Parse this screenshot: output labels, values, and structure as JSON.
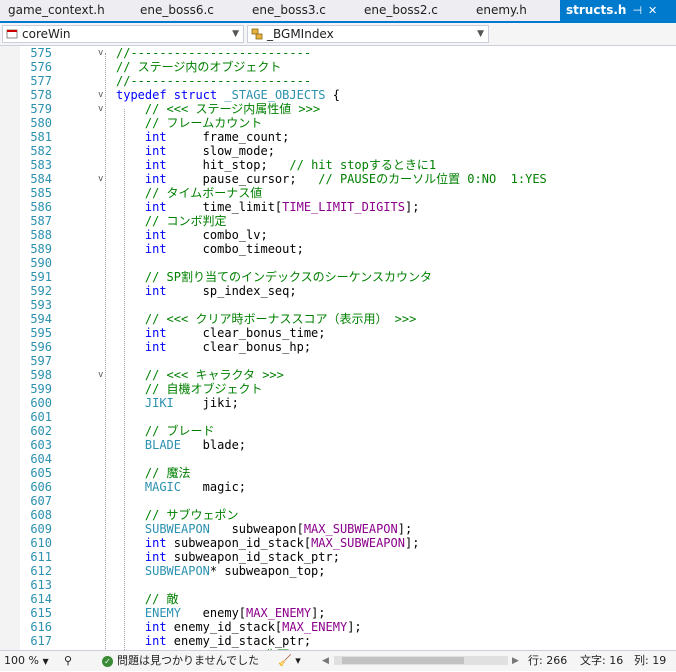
{
  "tabs": [
    {
      "label": "game_context.h"
    },
    {
      "label": "ene_boss6.c"
    },
    {
      "label": "ene_boss3.c"
    },
    {
      "label": "ene_boss2.c"
    },
    {
      "label": "enemy.h"
    },
    {
      "label": "structs.h",
      "pin": "⊣",
      "close": "✕"
    }
  ],
  "nav": {
    "scope": "coreWin",
    "member": "_BGMIndex"
  },
  "code_lines": [
    {
      "n": "575",
      "fold": "v",
      "seg": [
        [
          "c",
          "//-------------------------"
        ]
      ]
    },
    {
      "n": "576",
      "seg": [
        [
          "c",
          "// ステージ内のオブジェクト"
        ]
      ]
    },
    {
      "n": "577",
      "seg": [
        [
          "c",
          "//-------------------------"
        ]
      ]
    },
    {
      "n": "578",
      "fold": "v",
      "indent": 0,
      "seg": [
        [
          "k",
          "typedef struct "
        ],
        [
          "t",
          "_STAGE_OBJECTS"
        ],
        [
          "x",
          " {"
        ]
      ]
    },
    {
      "n": "579",
      "fold": "v",
      "indent": 1,
      "seg": [
        [
          "c",
          "// <<< ステージ内属性値 >>>"
        ]
      ]
    },
    {
      "n": "580",
      "indent": 1,
      "seg": [
        [
          "c",
          "// フレームカウント"
        ]
      ]
    },
    {
      "n": "581",
      "indent": 1,
      "seg": [
        [
          "k",
          "int"
        ],
        [
          "x",
          "     frame_count;"
        ]
      ]
    },
    {
      "n": "582",
      "indent": 1,
      "seg": [
        [
          "k",
          "int"
        ],
        [
          "x",
          "     slow_mode;"
        ]
      ]
    },
    {
      "n": "583",
      "indent": 1,
      "seg": [
        [
          "k",
          "int"
        ],
        [
          "x",
          "     hit_stop;   "
        ],
        [
          "c",
          "// hit stopするときに1"
        ]
      ]
    },
    {
      "n": "584",
      "fold": "v",
      "indent": 1,
      "seg": [
        [
          "k",
          "int"
        ],
        [
          "x",
          "     pause_cursor;   "
        ],
        [
          "c",
          "// PAUSEのカーソル位置 0:NO  1:YES"
        ]
      ]
    },
    {
      "n": "585",
      "indent": 1,
      "seg": [
        [
          "c",
          "// タイムボーナス値"
        ]
      ]
    },
    {
      "n": "586",
      "indent": 1,
      "seg": [
        [
          "k",
          "int"
        ],
        [
          "x",
          "     time_limit["
        ],
        [
          "m",
          "TIME_LIMIT_DIGITS"
        ],
        [
          "x",
          "];"
        ]
      ]
    },
    {
      "n": "587",
      "indent": 1,
      "seg": [
        [
          "c",
          "// コンボ判定"
        ]
      ]
    },
    {
      "n": "588",
      "indent": 1,
      "seg": [
        [
          "k",
          "int"
        ],
        [
          "x",
          "     combo_lv;"
        ]
      ]
    },
    {
      "n": "589",
      "indent": 1,
      "seg": [
        [
          "k",
          "int"
        ],
        [
          "x",
          "     combo_timeout;"
        ]
      ]
    },
    {
      "n": "590",
      "indent": 1,
      "seg": []
    },
    {
      "n": "591",
      "indent": 1,
      "seg": [
        [
          "c",
          "// SP割り当てのインデックスのシーケンスカウンタ"
        ]
      ]
    },
    {
      "n": "592",
      "indent": 1,
      "seg": [
        [
          "k",
          "int"
        ],
        [
          "x",
          "     sp_index_seq;"
        ]
      ]
    },
    {
      "n": "593",
      "indent": 1,
      "seg": []
    },
    {
      "n": "594",
      "indent": 1,
      "seg": [
        [
          "c",
          "// <<< クリア時ボーナススコア（表示用） >>>"
        ]
      ]
    },
    {
      "n": "595",
      "indent": 1,
      "seg": [
        [
          "k",
          "int"
        ],
        [
          "x",
          "     clear_bonus_time;"
        ]
      ]
    },
    {
      "n": "596",
      "indent": 1,
      "seg": [
        [
          "k",
          "int"
        ],
        [
          "x",
          "     clear_bonus_hp;"
        ]
      ]
    },
    {
      "n": "597",
      "indent": 1,
      "seg": []
    },
    {
      "n": "598",
      "fold": "v",
      "indent": 1,
      "seg": [
        [
          "c",
          "// <<< キャラクタ >>>"
        ]
      ]
    },
    {
      "n": "599",
      "indent": 1,
      "seg": [
        [
          "c",
          "// 自機オブジェクト"
        ]
      ]
    },
    {
      "n": "600",
      "indent": 1,
      "seg": [
        [
          "t",
          "JIKI"
        ],
        [
          "x",
          "    jiki;"
        ]
      ]
    },
    {
      "n": "601",
      "indent": 1,
      "seg": []
    },
    {
      "n": "602",
      "indent": 1,
      "seg": [
        [
          "c",
          "// ブレード"
        ]
      ]
    },
    {
      "n": "603",
      "indent": 1,
      "seg": [
        [
          "t",
          "BLADE"
        ],
        [
          "x",
          "   blade;"
        ]
      ]
    },
    {
      "n": "604",
      "indent": 1,
      "seg": []
    },
    {
      "n": "605",
      "indent": 1,
      "seg": [
        [
          "c",
          "// 魔法"
        ]
      ]
    },
    {
      "n": "606",
      "indent": 1,
      "seg": [
        [
          "t",
          "MAGIC"
        ],
        [
          "x",
          "   magic;"
        ]
      ]
    },
    {
      "n": "607",
      "indent": 1,
      "seg": []
    },
    {
      "n": "608",
      "indent": 1,
      "seg": [
        [
          "c",
          "// サブウェポン"
        ]
      ]
    },
    {
      "n": "609",
      "indent": 1,
      "seg": [
        [
          "t",
          "SUBWEAPON"
        ],
        [
          "x",
          "   subweapon["
        ],
        [
          "m",
          "MAX_SUBWEAPON"
        ],
        [
          "x",
          "];"
        ]
      ]
    },
    {
      "n": "610",
      "indent": 1,
      "seg": [
        [
          "k",
          "int"
        ],
        [
          "x",
          " subweapon_id_stack["
        ],
        [
          "m",
          "MAX_SUBWEAPON"
        ],
        [
          "x",
          "];"
        ]
      ]
    },
    {
      "n": "611",
      "indent": 1,
      "seg": [
        [
          "k",
          "int"
        ],
        [
          "x",
          " subweapon_id_stack_ptr;"
        ]
      ]
    },
    {
      "n": "612",
      "indent": 1,
      "seg": [
        [
          "t",
          "SUBWEAPON"
        ],
        [
          "x",
          "* subweapon_top;"
        ]
      ]
    },
    {
      "n": "613",
      "indent": 1,
      "seg": []
    },
    {
      "n": "614",
      "indent": 1,
      "seg": [
        [
          "c",
          "// 敵"
        ]
      ]
    },
    {
      "n": "615",
      "indent": 1,
      "seg": [
        [
          "t",
          "ENEMY"
        ],
        [
          "x",
          "   enemy["
        ],
        [
          "m",
          "MAX_ENEMY"
        ],
        [
          "x",
          "];"
        ]
      ]
    },
    {
      "n": "616",
      "indent": 1,
      "seg": [
        [
          "k",
          "int"
        ],
        [
          "x",
          " enemy_id_stack["
        ],
        [
          "m",
          "MAX_ENEMY"
        ],
        [
          "x",
          "];"
        ]
      ]
    },
    {
      "n": "617",
      "indent": 1,
      "seg": [
        [
          "k",
          "int"
        ],
        [
          "x",
          " enemy_id_stack_ptr;"
        ]
      ]
    },
    {
      "n": "618",
      "indent": 1,
      "seg": [
        [
          "t",
          "ENEMY"
        ],
        [
          "x",
          "* "
        ],
        [
          "c",
          "// リストの先頭"
        ]
      ]
    }
  ],
  "status": {
    "zoom": "100 %",
    "issues": "問題は見つかりませんでした",
    "line": "行: 266",
    "char": "文字: 16",
    "col": "列: 19"
  },
  "colors": {
    "accent": "#007acc",
    "comment": "#008000",
    "keyword": "#0000ff",
    "type": "#2b91af",
    "macro": "#8b008b"
  }
}
